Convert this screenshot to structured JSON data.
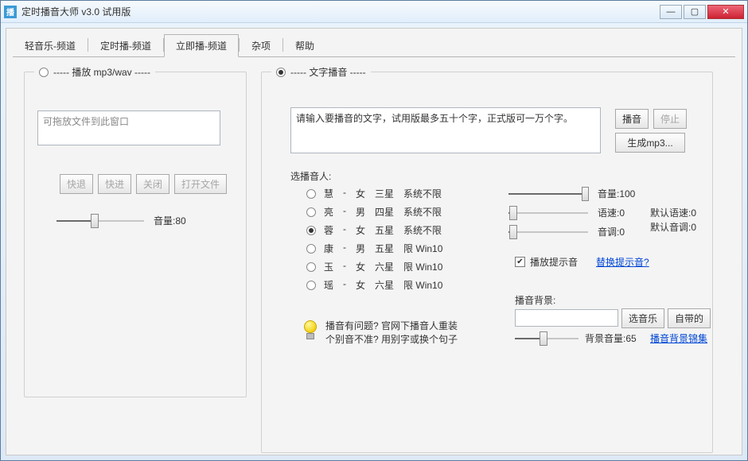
{
  "window": {
    "title": "定时播音大师 v3.0 试用版"
  },
  "tabs": [
    "轻音乐-频道",
    "定时播-频道",
    "立即播-频道",
    "杂项",
    "帮助"
  ],
  "active_tab_index": 2,
  "left": {
    "header": "----- 播放 mp3/wav -----",
    "drop_hint": "可拖放文件到此窗口",
    "btn_back": "快退",
    "btn_fwd": "快进",
    "btn_close": "关闭",
    "btn_open": "打开文件",
    "volume_label": "音量:80",
    "volume_pct": 40
  },
  "right": {
    "header": "----- 文字播音 -----",
    "textarea_placeholder": "请输入要播音的文字，试用版最多五十个字，正式版可一万个字。",
    "btn_play": "播音",
    "btn_stop": "停止",
    "btn_genmp3": "生成mp3...",
    "voice_label": "选播音人:",
    "voices": [
      {
        "name": "慧",
        "gender": "女",
        "stars": "三星",
        "sys": "系统不限",
        "checked": false
      },
      {
        "name": "亮",
        "gender": "男",
        "stars": "四星",
        "sys": "系统不限",
        "checked": false
      },
      {
        "name": "蓉",
        "gender": "女",
        "stars": "五星",
        "sys": "系统不限",
        "checked": true
      },
      {
        "name": "康",
        "gender": "男",
        "stars": "五星",
        "sys": "限 Win10",
        "checked": false
      },
      {
        "name": "玉",
        "gender": "女",
        "stars": "六星",
        "sys": "限 Win10",
        "checked": false
      },
      {
        "name": "瑶",
        "gender": "女",
        "stars": "六星",
        "sys": "限 Win10",
        "checked": false
      }
    ],
    "vol_label": "音量:100",
    "vol_pct": 100,
    "speed_label": "语速:0",
    "speed_pct": 2,
    "pitch_label": "音调:0",
    "pitch_pct": 2,
    "default_speed": "默认语速:0",
    "default_pitch": "默认音调:0",
    "play_prompt_checkbox": "播放提示音",
    "replace_prompt_link": "替换提示音?",
    "bg_label": "播音背景:",
    "btn_choose_music": "选音乐",
    "btn_builtin": "自带的",
    "bg_vol_label": "背景音量:65",
    "bg_vol_pct": 40,
    "bg_link": "播音背景锦集",
    "hint1": "播音有问题? 官网下播音人重装",
    "hint2": "个别音不准? 用别字或换个句子"
  }
}
